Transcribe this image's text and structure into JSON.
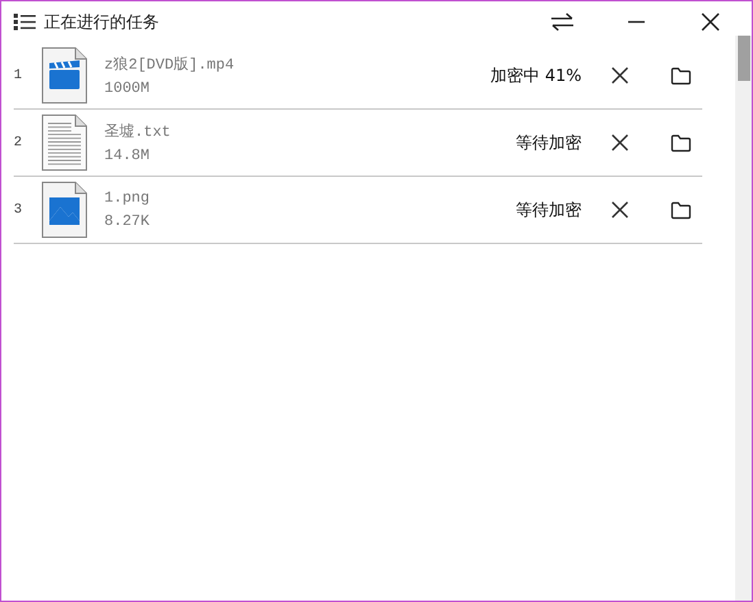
{
  "window": {
    "title": "正在进行的任务"
  },
  "tasks": [
    {
      "index": "1",
      "kind": "video",
      "name": "z狼2[DVD版].mp4",
      "size": "1000M",
      "status": "加密中 41%"
    },
    {
      "index": "2",
      "kind": "text",
      "name": "圣墟.txt",
      "size": "14.8M",
      "status": "等待加密"
    },
    {
      "index": "3",
      "kind": "image",
      "name": "1.png",
      "size": "8.27K",
      "status": "等待加密"
    }
  ]
}
